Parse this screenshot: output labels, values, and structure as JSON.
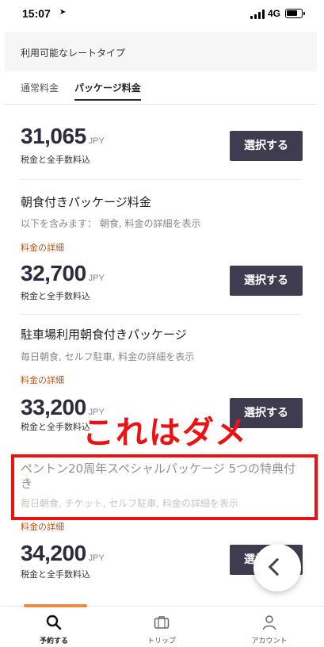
{
  "status_bar": {
    "time": "15:07",
    "network": "4G",
    "battery_level": 0.7
  },
  "rate_section": {
    "title": "利用可能なレートタイプ"
  },
  "tabs": [
    {
      "label": "通常料金",
      "active": false
    },
    {
      "label": "パッケージ料金",
      "active": true
    }
  ],
  "offers": [
    {
      "price": "31,065",
      "currency": "JPY",
      "tax_note": "税金と全手数料込",
      "button": "選択する"
    },
    {
      "name": "朝食付きパッケージ料金",
      "includes": "以下を含みます： 朝食, 料金の詳細を表示",
      "details_link": "料金の詳細",
      "price": "32,700",
      "currency": "JPY",
      "tax_note": "税金と全手数料込",
      "button": "選択する"
    },
    {
      "name": "駐車場利用朝食付きパッケージ",
      "includes": "毎日朝食, セルフ駐車, 料金の詳細を表示",
      "details_link": "料金の詳細",
      "price": "33,200",
      "currency": "JPY",
      "tax_note": "税金と全手数料込",
      "button": "選択する"
    },
    {
      "name": "ペントン20周年スペシャルパッケージ 5つの特典付き",
      "includes": "毎日朝食, チケット, セルフ駐車, 料金の詳細を表示",
      "details_link": "料金の詳細",
      "price": "34,200",
      "currency": "JPY",
      "tax_note": "税金と全手数料込",
      "button": "選択する"
    }
  ],
  "annotation": {
    "text": "これはダメ",
    "color": "#ee1111"
  },
  "bottom_nav": [
    {
      "label": "予約する",
      "icon": "search-icon",
      "active": true
    },
    {
      "label": "トリップ",
      "icon": "suitcase-icon",
      "active": false
    },
    {
      "label": "アカウント",
      "icon": "person-icon",
      "active": false
    }
  ],
  "colors": {
    "accent": "#f08a3c",
    "button": "#403c50",
    "link": "#b5541a",
    "highlight": "#ee1111"
  }
}
